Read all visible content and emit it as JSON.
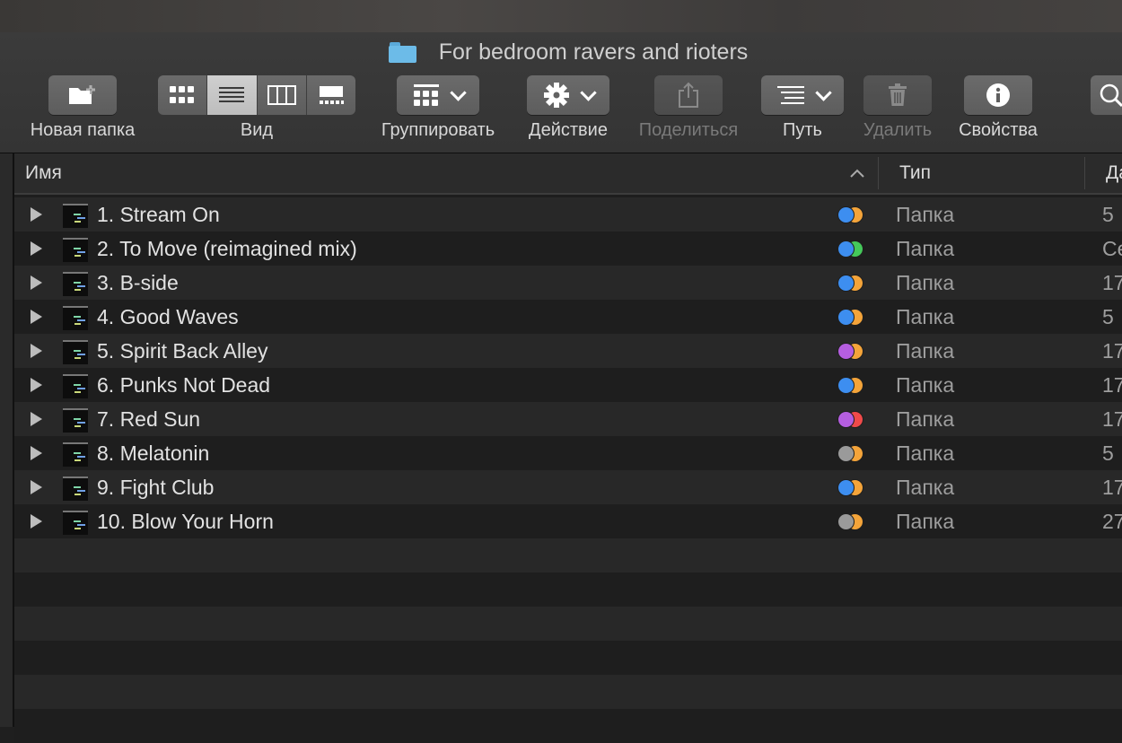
{
  "window": {
    "title": "For bedroom ravers and rioters"
  },
  "toolbar": {
    "new_folder_label": "Новая папка",
    "view_label": "Вид",
    "group_label": "Группировать",
    "action_label": "Действие",
    "share_label": "Поделиться",
    "path_label": "Путь",
    "delete_label": "Удалить",
    "info_label": "Свойства",
    "view_modes": [
      "icons",
      "list",
      "columns",
      "gallery"
    ],
    "active_view": "list"
  },
  "list": {
    "columns": {
      "name": "Имя",
      "kind": "Тип",
      "date": "Да"
    },
    "sort_indicator": "ascending",
    "rows": [
      {
        "name": "1. Stream On",
        "kind": "Папка",
        "date": "5",
        "tags": [
          "#3d8ef0",
          "#f4a43a"
        ]
      },
      {
        "name": "2. To Move (reimagined mix)",
        "kind": "Папка",
        "date": "Се",
        "tags": [
          "#3d8ef0",
          "#45c85a"
        ]
      },
      {
        "name": "3. B-side",
        "kind": "Папка",
        "date": "17",
        "tags": [
          "#3d8ef0",
          "#f4a43a"
        ]
      },
      {
        "name": "4. Good Waves",
        "kind": "Папка",
        "date": "5",
        "tags": [
          "#3d8ef0",
          "#f4a43a"
        ]
      },
      {
        "name": "5. Spirit Back Alley",
        "kind": "Папка",
        "date": "17",
        "tags": [
          "#b55ee0",
          "#f4a43a"
        ]
      },
      {
        "name": "6. Punks Not Dead",
        "kind": "Папка",
        "date": "17",
        "tags": [
          "#3d8ef0",
          "#f4a43a"
        ]
      },
      {
        "name": "7. Red Sun",
        "kind": "Папка",
        "date": "17",
        "tags": [
          "#b55ee0",
          "#ef4a4a"
        ]
      },
      {
        "name": "8. Melatonin",
        "kind": "Папка",
        "date": "5",
        "tags": [
          "#9a9a9a",
          "#f4a43a"
        ]
      },
      {
        "name": "9. Fight Club",
        "kind": "Папка",
        "date": "17",
        "tags": [
          "#3d8ef0",
          "#f4a43a"
        ]
      },
      {
        "name": "10. Blow Your Horn",
        "kind": "Папка",
        "date": "27",
        "tags": [
          "#9a9a9a",
          "#f4a43a"
        ]
      }
    ],
    "empty_rows": 6
  }
}
